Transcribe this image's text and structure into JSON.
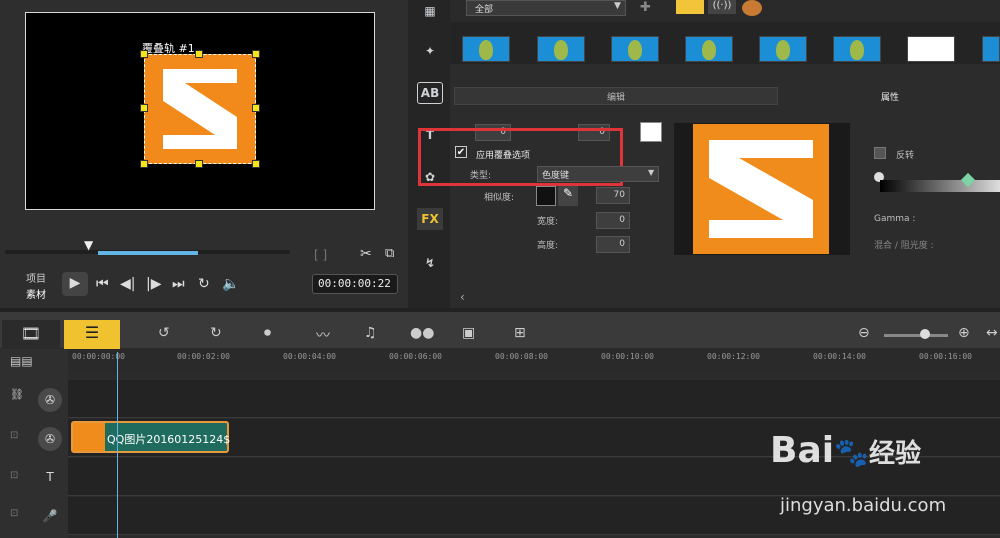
{
  "preview": {
    "overlay_title": "覆叠轨 #1",
    "project_label": "项目",
    "clip_label": "素材",
    "timecode": "00:00:00:22"
  },
  "library": {
    "category": "全部",
    "tabs": {
      "edit": "编辑",
      "attributes": "属性"
    }
  },
  "overlay_options": {
    "apply_label": "应用覆叠选项",
    "type_label": "类型:",
    "type_value": "色度键",
    "similarity_label": "相似度:",
    "similarity_value": "70",
    "width_label": "宽度:",
    "width_value": "0",
    "height_label": "高度:",
    "height_value": "0",
    "top_value_1": "0",
    "top_value_2": "0"
  },
  "attributes": {
    "invert_label": "反转",
    "gamma_label": "Gamma :",
    "blend_label": "混合 / 阻光度 :"
  },
  "side_tools": {
    "title": "AB",
    "fx": "FX"
  },
  "timeline": {
    "ticks": [
      "00:00:00:00",
      "00:00:02:00",
      "00:00:04:00",
      "00:00:06:00",
      "00:00:08:00",
      "00:00:10:00",
      "00:00:12:00",
      "00:00:14:00",
      "00:00:16:00"
    ],
    "clip_name": "QQ图片20160125124$"
  },
  "watermark": {
    "brand": "Bai",
    "suffix": "经验",
    "url": "jingyan.baidu.com"
  },
  "colors": {
    "accent": "#62b5e5",
    "orange": "#f18a1b",
    "highlight": "#e0343b"
  }
}
